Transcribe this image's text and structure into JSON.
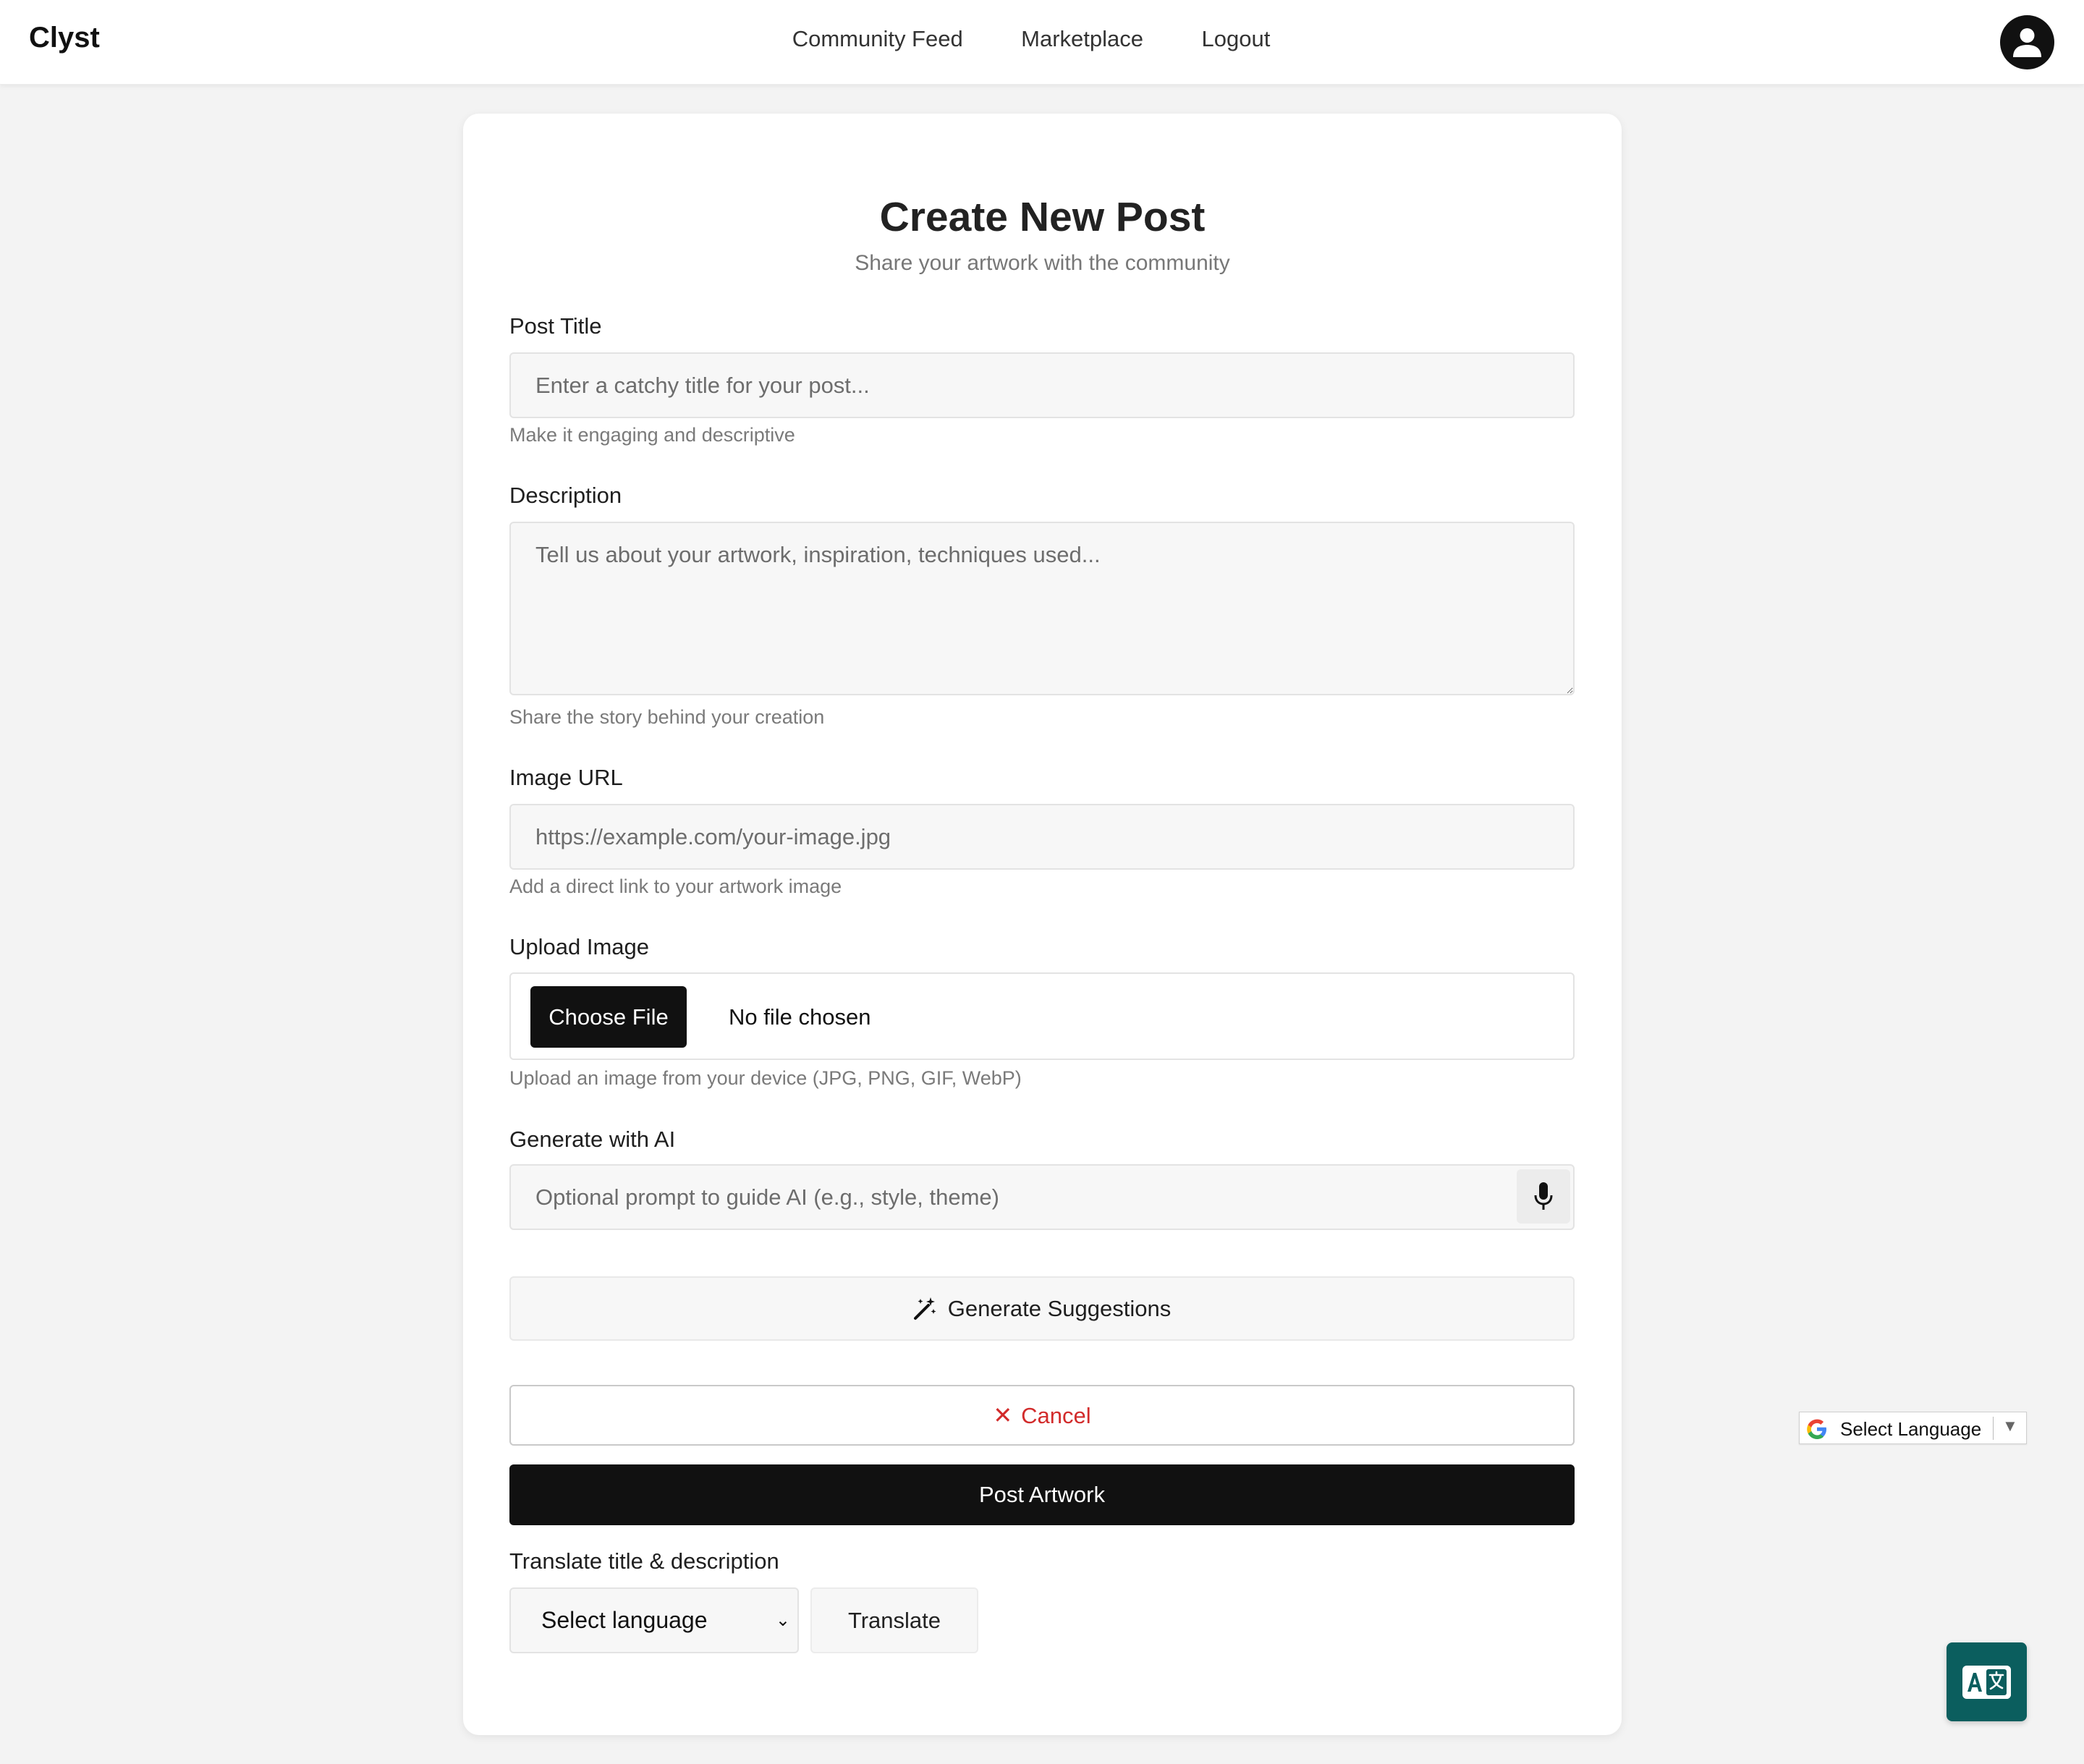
{
  "brand": "Clyst",
  "nav": {
    "links": [
      "Community Feed",
      "Marketplace",
      "Logout"
    ]
  },
  "icons": {
    "avatar": "account-circle-icon",
    "mic": "microphone-icon",
    "generate": "magic-wand-icon",
    "cancel": "close-icon",
    "translate_fab": "translate-icon",
    "google": "google-logo-icon"
  },
  "colors": {
    "accent_dark": "#111111",
    "cancel_red": "#d22b2b",
    "fab_teal": "#0b5e5e"
  },
  "form": {
    "title": "Create New Post",
    "subtitle": "Share your artwork with the community",
    "post_title": {
      "label": "Post Title",
      "placeholder": "Enter a catchy title for your post...",
      "hint": "Make it engaging and descriptive"
    },
    "description": {
      "label": "Description",
      "placeholder": "Tell us about your artwork, inspiration, techniques used...",
      "hint": "Share the story behind your creation"
    },
    "image_url": {
      "label": "Image URL",
      "placeholder": "https://example.com/your-image.jpg",
      "hint": "Add a direct link to your artwork image"
    },
    "upload": {
      "label": "Upload Image",
      "button": "Choose File",
      "status": "No file chosen",
      "hint": "Upload an image from your device (JPG, PNG, GIF, WebP)"
    },
    "ai": {
      "label": "Generate with AI",
      "placeholder": "Optional prompt to guide AI (e.g., style, theme)",
      "generate_button": "Generate Suggestions"
    },
    "cancel_button": "Cancel",
    "submit_button": "Post Artwork",
    "translate": {
      "label": "Translate title & description",
      "select_value": "Select language",
      "button": "Translate"
    }
  },
  "google_translate": {
    "label": "Select Language"
  }
}
